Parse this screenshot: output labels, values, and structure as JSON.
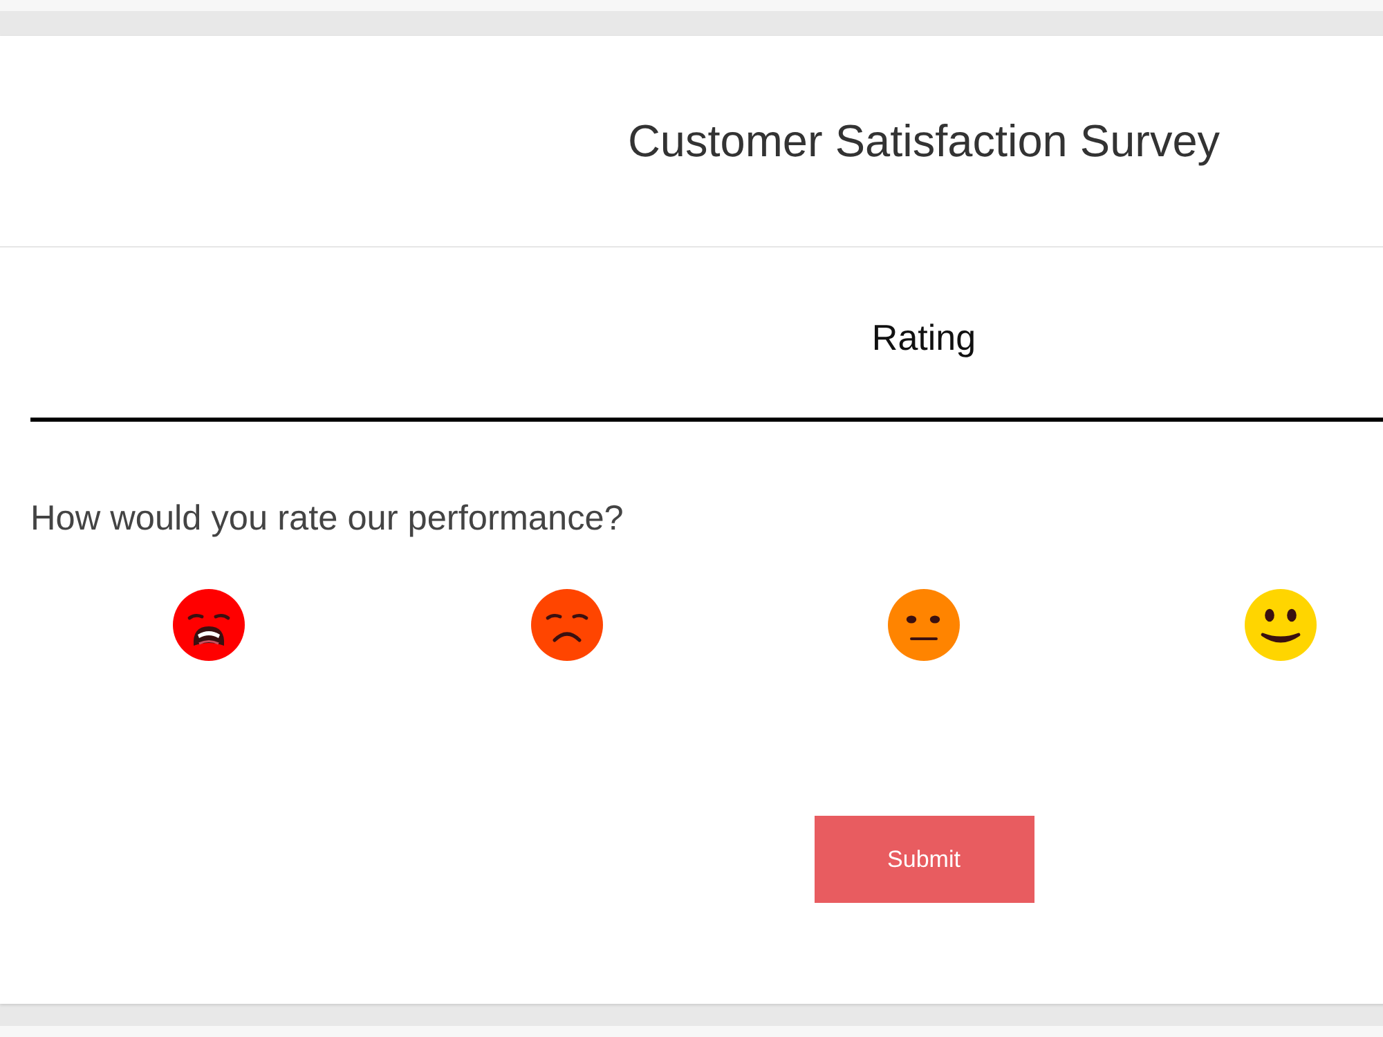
{
  "header": {
    "title": "Customer Satisfaction Survey"
  },
  "section": {
    "title": "Rating"
  },
  "question": {
    "text": "How would you rate our performance?",
    "options": [
      {
        "kind": "weary",
        "color": "#ff0000",
        "selected": false
      },
      {
        "kind": "sad",
        "color": "#ff4500",
        "selected": false
      },
      {
        "kind": "neutral",
        "color": "#ff8400",
        "selected": false
      },
      {
        "kind": "smile",
        "color": "#ffd500",
        "selected": false
      }
    ]
  },
  "submit_button": {
    "label": "Submit"
  }
}
